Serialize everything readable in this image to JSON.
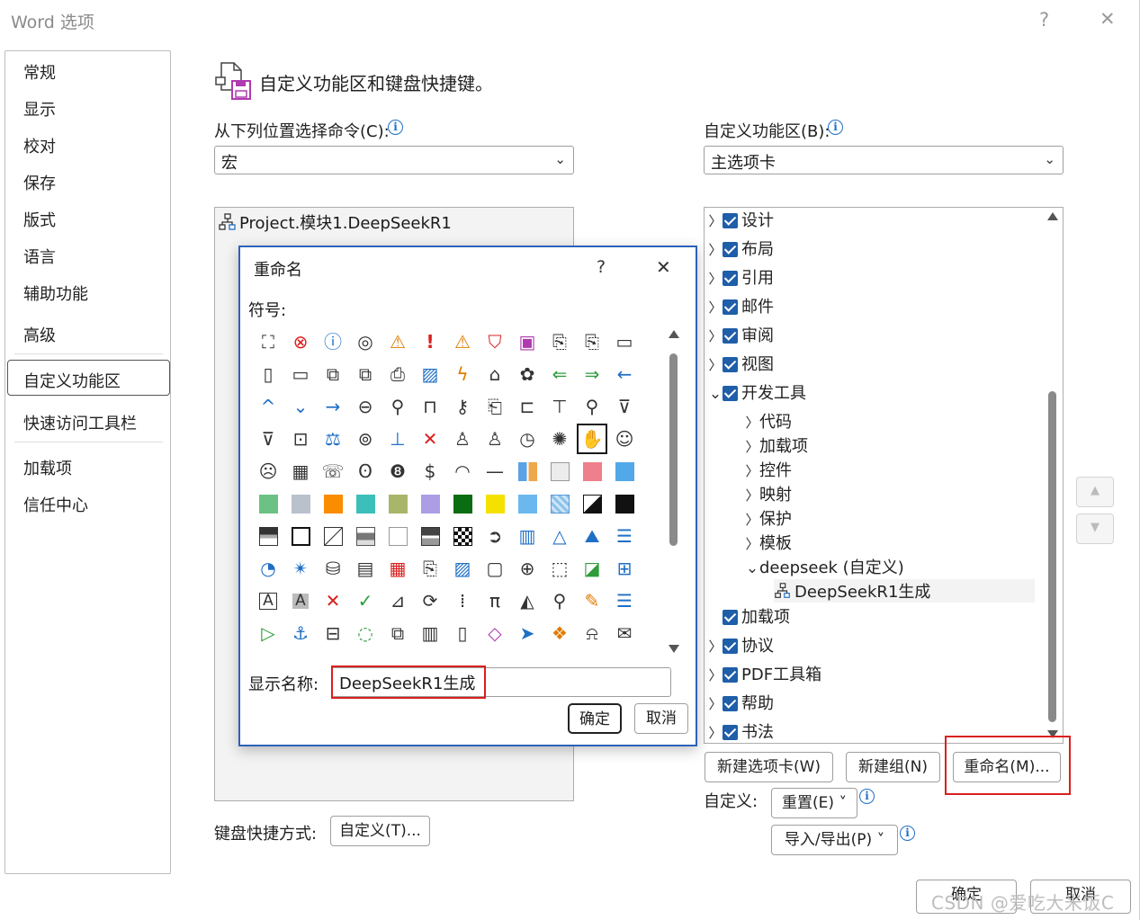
{
  "window": {
    "title": "Word 选项",
    "help_glyph": "?",
    "close_glyph": "✕"
  },
  "nav": {
    "items": [
      "常规",
      "显示",
      "校对",
      "保存",
      "版式",
      "语言",
      "辅助功能",
      "高级",
      "自定义功能区",
      "快速访问工具栏",
      "加载项",
      "信任中心"
    ],
    "selected": "自定义功能区"
  },
  "header": {
    "title": "自定义功能区和键盘快捷键。"
  },
  "left": {
    "choose_label": "从下列位置选择命令(C):",
    "choose_value": "宏",
    "list_item": "Project.模块1.DeepSeekR1",
    "shortcut_label": "键盘快捷方式:",
    "shortcut_button": "自定义(T)..."
  },
  "right": {
    "customize_label": "自定义功能区(B):",
    "customize_value": "主选项卡",
    "tree": [
      {
        "label": "设计",
        "level": 0,
        "checked": true,
        "expander": "right"
      },
      {
        "label": "布局",
        "level": 0,
        "checked": true,
        "expander": "right"
      },
      {
        "label": "引用",
        "level": 0,
        "checked": true,
        "expander": "right"
      },
      {
        "label": "邮件",
        "level": 0,
        "checked": true,
        "expander": "right"
      },
      {
        "label": "审阅",
        "level": 0,
        "checked": true,
        "expander": "right"
      },
      {
        "label": "视图",
        "level": 0,
        "checked": true,
        "expander": "right"
      },
      {
        "label": "开发工具",
        "level": 0,
        "checked": true,
        "expander": "down"
      },
      {
        "label": "代码",
        "level": 1,
        "expander": "right"
      },
      {
        "label": "加载项",
        "level": 1,
        "expander": "right"
      },
      {
        "label": "控件",
        "level": 1,
        "expander": "right"
      },
      {
        "label": "映射",
        "level": 1,
        "expander": "right"
      },
      {
        "label": "保护",
        "level": 1,
        "expander": "right"
      },
      {
        "label": "模板",
        "level": 1,
        "expander": "right"
      },
      {
        "label": "deepseek (自定义)",
        "level": 1,
        "expander": "down"
      },
      {
        "label": "DeepSeekR1生成",
        "level": 2,
        "selected": true
      },
      {
        "label": "加载项",
        "level": 0,
        "checked": true,
        "expander": "none"
      },
      {
        "label": "协议",
        "level": 0,
        "checked": true,
        "expander": "right"
      },
      {
        "label": "PDF工具箱",
        "level": 0,
        "checked": true,
        "expander": "right"
      },
      {
        "label": "帮助",
        "level": 0,
        "checked": true,
        "expander": "right"
      },
      {
        "label": "书法",
        "level": 0,
        "checked": true,
        "expander": "right"
      }
    ],
    "new_tab_button": "新建选项卡(W)",
    "new_group_button": "新建组(N)",
    "rename_button": "重命名(M)...",
    "customize_text": "自定义:",
    "reset_button": "重置(E) ˅",
    "import_export_button": "导入/导出(P) ˅"
  },
  "footer": {
    "ok": "确定",
    "cancel": "取消"
  },
  "watermark": "CSDN @爱吃大米饭C",
  "dialog": {
    "title": "重命名",
    "help_glyph": "?",
    "close_glyph": "✕",
    "symbol_label": "符号:",
    "display_name_label": "显示名称:",
    "display_name_value": "DeepSeekR1生成",
    "ok": "确定",
    "cancel": "取消",
    "selected_symbol_index": 46,
    "symbols": [
      {
        "icon": "org-chart-icon",
        "t": "g",
        "c": "#333"
      },
      {
        "icon": "error-circle-icon",
        "t": "g",
        "c": "#d9201e"
      },
      {
        "icon": "info-circle-icon",
        "t": "g",
        "c": "#1f6fc5"
      },
      {
        "icon": "target-icon",
        "t": "g",
        "c": "#333"
      },
      {
        "icon": "warning-triangle-icon",
        "t": "g",
        "c": "#e07b00"
      },
      {
        "icon": "exclamation-icon",
        "t": "g",
        "c": "#d9201e"
      },
      {
        "icon": "warning-triangle-2-icon",
        "t": "g",
        "c": "#e07b00"
      },
      {
        "icon": "shield-icon",
        "t": "g",
        "c": "#d9201e"
      },
      {
        "icon": "save-disk-icon",
        "t": "g",
        "c": "#b03ab0"
      },
      {
        "icon": "document-refresh-icon",
        "t": "g",
        "c": "#333"
      },
      {
        "icon": "document-arrow-icon",
        "t": "g",
        "c": "#333"
      },
      {
        "icon": "folder-icon",
        "t": "g",
        "c": "#333"
      },
      {
        "icon": "blank-page-icon",
        "t": "g",
        "c": "#333"
      },
      {
        "icon": "open-folder-icon",
        "t": "g",
        "c": "#333"
      },
      {
        "icon": "copy-icon",
        "t": "g",
        "c": "#333"
      },
      {
        "icon": "folder-send-icon",
        "t": "g",
        "c": "#333"
      },
      {
        "icon": "printer-icon",
        "t": "g",
        "c": "#333"
      },
      {
        "icon": "picture-icon",
        "t": "g",
        "c": "#1f6fc5"
      },
      {
        "icon": "lightning-doc-icon",
        "t": "g",
        "c": "#e07b00"
      },
      {
        "icon": "home-icon",
        "t": "g",
        "c": "#333"
      },
      {
        "icon": "palette-icon",
        "t": "g",
        "c": "#333"
      },
      {
        "icon": "arrow-left-green-icon",
        "t": "g",
        "c": "#2e9d3a"
      },
      {
        "icon": "arrow-right-green-icon",
        "t": "g",
        "c": "#2e9d3a"
      },
      {
        "icon": "arrow-left-blue-icon",
        "t": "g",
        "c": "#1f6fc5"
      },
      {
        "icon": "chevron-up-icon",
        "t": "g",
        "c": "#1f6fc5"
      },
      {
        "icon": "chevron-down-icon",
        "t": "g",
        "c": "#1f6fc5"
      },
      {
        "icon": "arrow-right-icon",
        "t": "g",
        "c": "#1f6fc5"
      },
      {
        "icon": "back-circle-icon",
        "t": "g",
        "c": "#333"
      },
      {
        "icon": "pin-icon",
        "t": "g",
        "c": "#333"
      },
      {
        "icon": "lock-icon",
        "t": "g",
        "c": "#333"
      },
      {
        "icon": "key-icon",
        "t": "g",
        "c": "#333"
      },
      {
        "icon": "scroll-icon",
        "t": "g",
        "c": "#333"
      },
      {
        "icon": "bookmark-icon",
        "t": "g",
        "c": "#333"
      },
      {
        "icon": "presentation-icon",
        "t": "g",
        "c": "#333"
      },
      {
        "icon": "search-icon",
        "t": "g",
        "c": "#333"
      },
      {
        "icon": "filter-icon",
        "t": "g",
        "c": "#333"
      },
      {
        "icon": "filter-2-icon",
        "t": "g",
        "c": "#333"
      },
      {
        "icon": "contact-card-icon",
        "t": "g",
        "c": "#333"
      },
      {
        "icon": "scales-icon",
        "t": "g",
        "c": "#1f6fc5"
      },
      {
        "icon": "overlap-circles-icon",
        "t": "g",
        "c": "#333"
      },
      {
        "icon": "microphone-icon",
        "t": "g",
        "c": "#1f6fc5"
      },
      {
        "icon": "mute-icon",
        "t": "g",
        "c": "#d9201e"
      },
      {
        "icon": "person-icon",
        "t": "g",
        "c": "#333"
      },
      {
        "icon": "person-outline-icon",
        "t": "g",
        "c": "#333"
      },
      {
        "icon": "clock-icon",
        "t": "g",
        "c": "#333"
      },
      {
        "icon": "sparkle-icon",
        "t": "g",
        "c": "#333"
      },
      {
        "icon": "hand-icon",
        "t": "g",
        "c": "#333"
      },
      {
        "icon": "smiley-icon",
        "t": "g",
        "c": "#333"
      },
      {
        "icon": "sad-face-icon",
        "t": "g",
        "c": "#333"
      },
      {
        "icon": "calculator-icon",
        "t": "g",
        "c": "#333"
      },
      {
        "icon": "phone-icon",
        "t": "g",
        "c": "#333"
      },
      {
        "icon": "piggy-bank-icon",
        "t": "g",
        "c": "#333"
      },
      {
        "icon": "eight-ball-icon",
        "t": "g",
        "c": "#333"
      },
      {
        "icon": "quote-dollar-icon",
        "t": "g",
        "c": "#333"
      },
      {
        "icon": "eye-icon",
        "t": "g",
        "c": "#333"
      },
      {
        "icon": "dash-icon",
        "t": "g",
        "c": "#333"
      },
      {
        "icon": "layout-tiles-icon",
        "t": "s",
        "c": "#5ba3e6"
      },
      {
        "icon": "light-gray-swatch-icon",
        "t": "s",
        "c": "#ececec"
      },
      {
        "icon": "pink-swatch-icon",
        "t": "s",
        "c": "#ef7f8a"
      },
      {
        "icon": "blue-swatch-icon",
        "t": "s",
        "c": "#52a8e8"
      },
      {
        "icon": "green-swatch-icon",
        "t": "s",
        "c": "#6cc284"
      },
      {
        "icon": "gray-swatch-icon",
        "t": "s",
        "c": "#b9c1cd"
      },
      {
        "icon": "orange-swatch-icon",
        "t": "s",
        "c": "#fa8c00"
      },
      {
        "icon": "teal-swatch-icon",
        "t": "s",
        "c": "#3bbfb8"
      },
      {
        "icon": "olive-swatch-icon",
        "t": "s",
        "c": "#a8b66a"
      },
      {
        "icon": "lavender-swatch-icon",
        "t": "s",
        "c": "#ad9de6"
      },
      {
        "icon": "dark-green-swatch-icon",
        "t": "s",
        "c": "#0a6d12"
      },
      {
        "icon": "yellow-swatch-icon",
        "t": "s",
        "c": "#f5e100"
      },
      {
        "icon": "sky-swatch-icon",
        "t": "s",
        "c": "#6cb8ee"
      },
      {
        "icon": "pattern-swatch-icon",
        "t": "s",
        "c": "#8cc2ea"
      },
      {
        "icon": "half-black-swatch-icon",
        "t": "s",
        "c": "#222222"
      },
      {
        "icon": "black-swatch-icon",
        "t": "s",
        "c": "#111111"
      },
      {
        "icon": "gradient-swatch-icon",
        "t": "s",
        "c": "#555555"
      },
      {
        "icon": "outline-swatch-icon",
        "t": "s",
        "c": "#ffffff"
      },
      {
        "icon": "diagonal-swatch-icon",
        "t": "s",
        "c": "#ffffff"
      },
      {
        "icon": "band-swatch-icon",
        "t": "s",
        "c": "#8a8a8a"
      },
      {
        "icon": "plain-swatch-icon",
        "t": "s",
        "c": "#ffffff"
      },
      {
        "icon": "dark-band-swatch-icon",
        "t": "s",
        "c": "#555555"
      },
      {
        "icon": "checker-swatch-icon",
        "t": "s",
        "c": "#222222"
      },
      {
        "icon": "arrow-circle-icon",
        "t": "g",
        "c": "#333"
      },
      {
        "icon": "bar-chart-icon",
        "t": "g",
        "c": "#1f6fc5"
      },
      {
        "icon": "pyramid-icon",
        "t": "g",
        "c": "#1f6fc5"
      },
      {
        "icon": "mountains-icon",
        "t": "g",
        "c": "#1f6fc5"
      },
      {
        "icon": "stacked-bars-icon",
        "t": "g",
        "c": "#1f6fc5"
      },
      {
        "icon": "pie-chart-icon",
        "t": "g",
        "c": "#1f6fc5"
      },
      {
        "icon": "radar-chart-icon",
        "t": "g",
        "c": "#1f6fc5"
      },
      {
        "icon": "database-icon",
        "t": "g",
        "c": "#333"
      },
      {
        "icon": "form-icon",
        "t": "g",
        "c": "#333"
      },
      {
        "icon": "table-red-icon",
        "t": "g",
        "c": "#d9201e"
      },
      {
        "icon": "doc-link-icon",
        "t": "g",
        "c": "#333"
      },
      {
        "icon": "area-chart-icon",
        "t": "g",
        "c": "#1f6fc5"
      },
      {
        "icon": "frame-icon",
        "t": "g",
        "c": "#333"
      },
      {
        "icon": "globe-page-icon",
        "t": "g",
        "c": "#333"
      },
      {
        "icon": "select-area-icon",
        "t": "g",
        "c": "#333"
      },
      {
        "icon": "contrast-icon",
        "t": "g",
        "c": "#2e9d3a"
      },
      {
        "icon": "hierarchy-icon",
        "t": "g",
        "c": "#1f6fc5"
      },
      {
        "icon": "text-box-icon",
        "t": "g",
        "c": "#333"
      },
      {
        "icon": "text-gray-icon",
        "t": "g",
        "c": "#333"
      },
      {
        "icon": "cross-icon",
        "t": "g",
        "c": "#d9201e"
      },
      {
        "icon": "checkmark-icon",
        "t": "g",
        "c": "#2e9d3a"
      },
      {
        "icon": "ruler-icon",
        "t": "g",
        "c": "#333"
      },
      {
        "icon": "refresh-icon",
        "t": "g",
        "c": "#333"
      },
      {
        "icon": "binary-icon",
        "t": "g",
        "c": "#333"
      },
      {
        "icon": "pi-icon",
        "t": "g",
        "c": "#333"
      },
      {
        "icon": "fill-bucket-icon",
        "t": "g",
        "c": "#333"
      },
      {
        "icon": "magnifier-icon",
        "t": "g",
        "c": "#333"
      },
      {
        "icon": "format-brush-icon",
        "t": "g",
        "c": "#e07b00"
      },
      {
        "icon": "bullet-list-icon",
        "t": "g",
        "c": "#1f6fc5"
      },
      {
        "icon": "play-icon",
        "t": "g",
        "c": "#2e9d3a"
      },
      {
        "icon": "anchor-icon",
        "t": "g",
        "c": "#1f6fc5"
      },
      {
        "icon": "toolbox-icon",
        "t": "g",
        "c": "#333"
      },
      {
        "icon": "dotted-circle-icon",
        "t": "g",
        "c": "#2e9d3a"
      },
      {
        "icon": "shapes-icon",
        "t": "g",
        "c": "#333"
      },
      {
        "icon": "columns-icon",
        "t": "g",
        "c": "#333"
      },
      {
        "icon": "tablet-icon",
        "t": "g",
        "c": "#333"
      },
      {
        "icon": "eraser-icon",
        "t": "g",
        "c": "#b03ab0"
      },
      {
        "icon": "send-icon",
        "t": "g",
        "c": "#1f6fc5"
      },
      {
        "icon": "office-logo-icon",
        "t": "g",
        "c": "#e07b00"
      },
      {
        "icon": "bell-icon",
        "t": "g",
        "c": "#333"
      },
      {
        "icon": "open-mail-icon",
        "t": "g",
        "c": "#333"
      }
    ]
  }
}
